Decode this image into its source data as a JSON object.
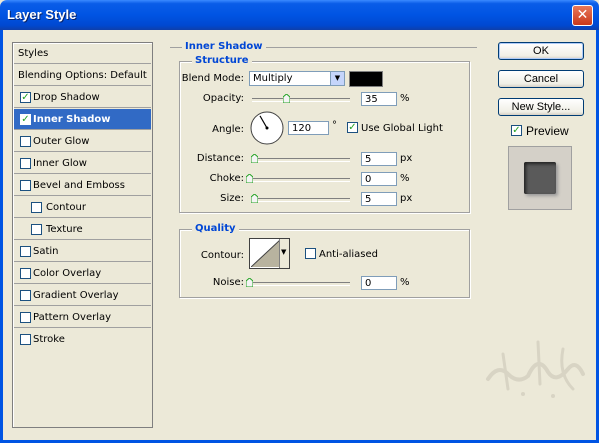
{
  "window": {
    "title": "Layer Style",
    "close_glyph": "✕"
  },
  "styles_list": {
    "items": [
      {
        "label": "Styles",
        "type": "header"
      },
      {
        "label": "Blending Options: Default",
        "type": "blend"
      },
      {
        "label": "Drop Shadow",
        "checked": true
      },
      {
        "label": "Inner Shadow",
        "checked": true,
        "selected": true
      },
      {
        "label": "Outer Glow",
        "checked": false
      },
      {
        "label": "Inner Glow",
        "checked": false
      },
      {
        "label": "Bevel and Emboss",
        "checked": false
      },
      {
        "label": "Contour",
        "checked": false,
        "indent": true
      },
      {
        "label": "Texture",
        "checked": false,
        "indent": true
      },
      {
        "label": "Satin",
        "checked": false
      },
      {
        "label": "Color Overlay",
        "checked": false
      },
      {
        "label": "Gradient Overlay",
        "checked": false
      },
      {
        "label": "Pattern Overlay",
        "checked": false
      },
      {
        "label": "Stroke",
        "checked": false
      }
    ]
  },
  "inner_shadow": {
    "title": "Inner Shadow",
    "structure": {
      "title": "Structure",
      "blend_mode_label": "Blend Mode:",
      "blend_mode_value": "Multiply",
      "color": "#000000",
      "opacity_label": "Opacity:",
      "opacity_value": "35",
      "opacity_unit": "%",
      "opacity_level": 0.35,
      "angle_label": "Angle:",
      "angle_value": "120",
      "angle_unit": "°",
      "use_global_light_label": "Use Global Light",
      "use_global_light": true,
      "distance_label": "Distance:",
      "distance_value": "5",
      "distance_unit": "px",
      "distance_level": 0.02,
      "choke_label": "Choke:",
      "choke_value": "0",
      "choke_unit": "%",
      "choke_level": 0,
      "size_label": "Size:",
      "size_value": "5",
      "size_unit": "px",
      "size_level": 0.02
    },
    "quality": {
      "title": "Quality",
      "contour_label": "Contour:",
      "anti_aliased_label": "Anti-aliased",
      "anti_aliased": false,
      "noise_label": "Noise:",
      "noise_value": "0",
      "noise_unit": "%",
      "noise_level": 0
    }
  },
  "buttons": {
    "ok": "OK",
    "cancel": "Cancel",
    "new_style": "New Style...",
    "preview_label": "Preview",
    "preview_checked": true
  },
  "watermark_text": "طرالغرام",
  "colors": {
    "title_bar": "#0054e3",
    "selection": "#316ac5",
    "group_title": "#0046d5",
    "dialog_bg": "#ece9d8"
  }
}
